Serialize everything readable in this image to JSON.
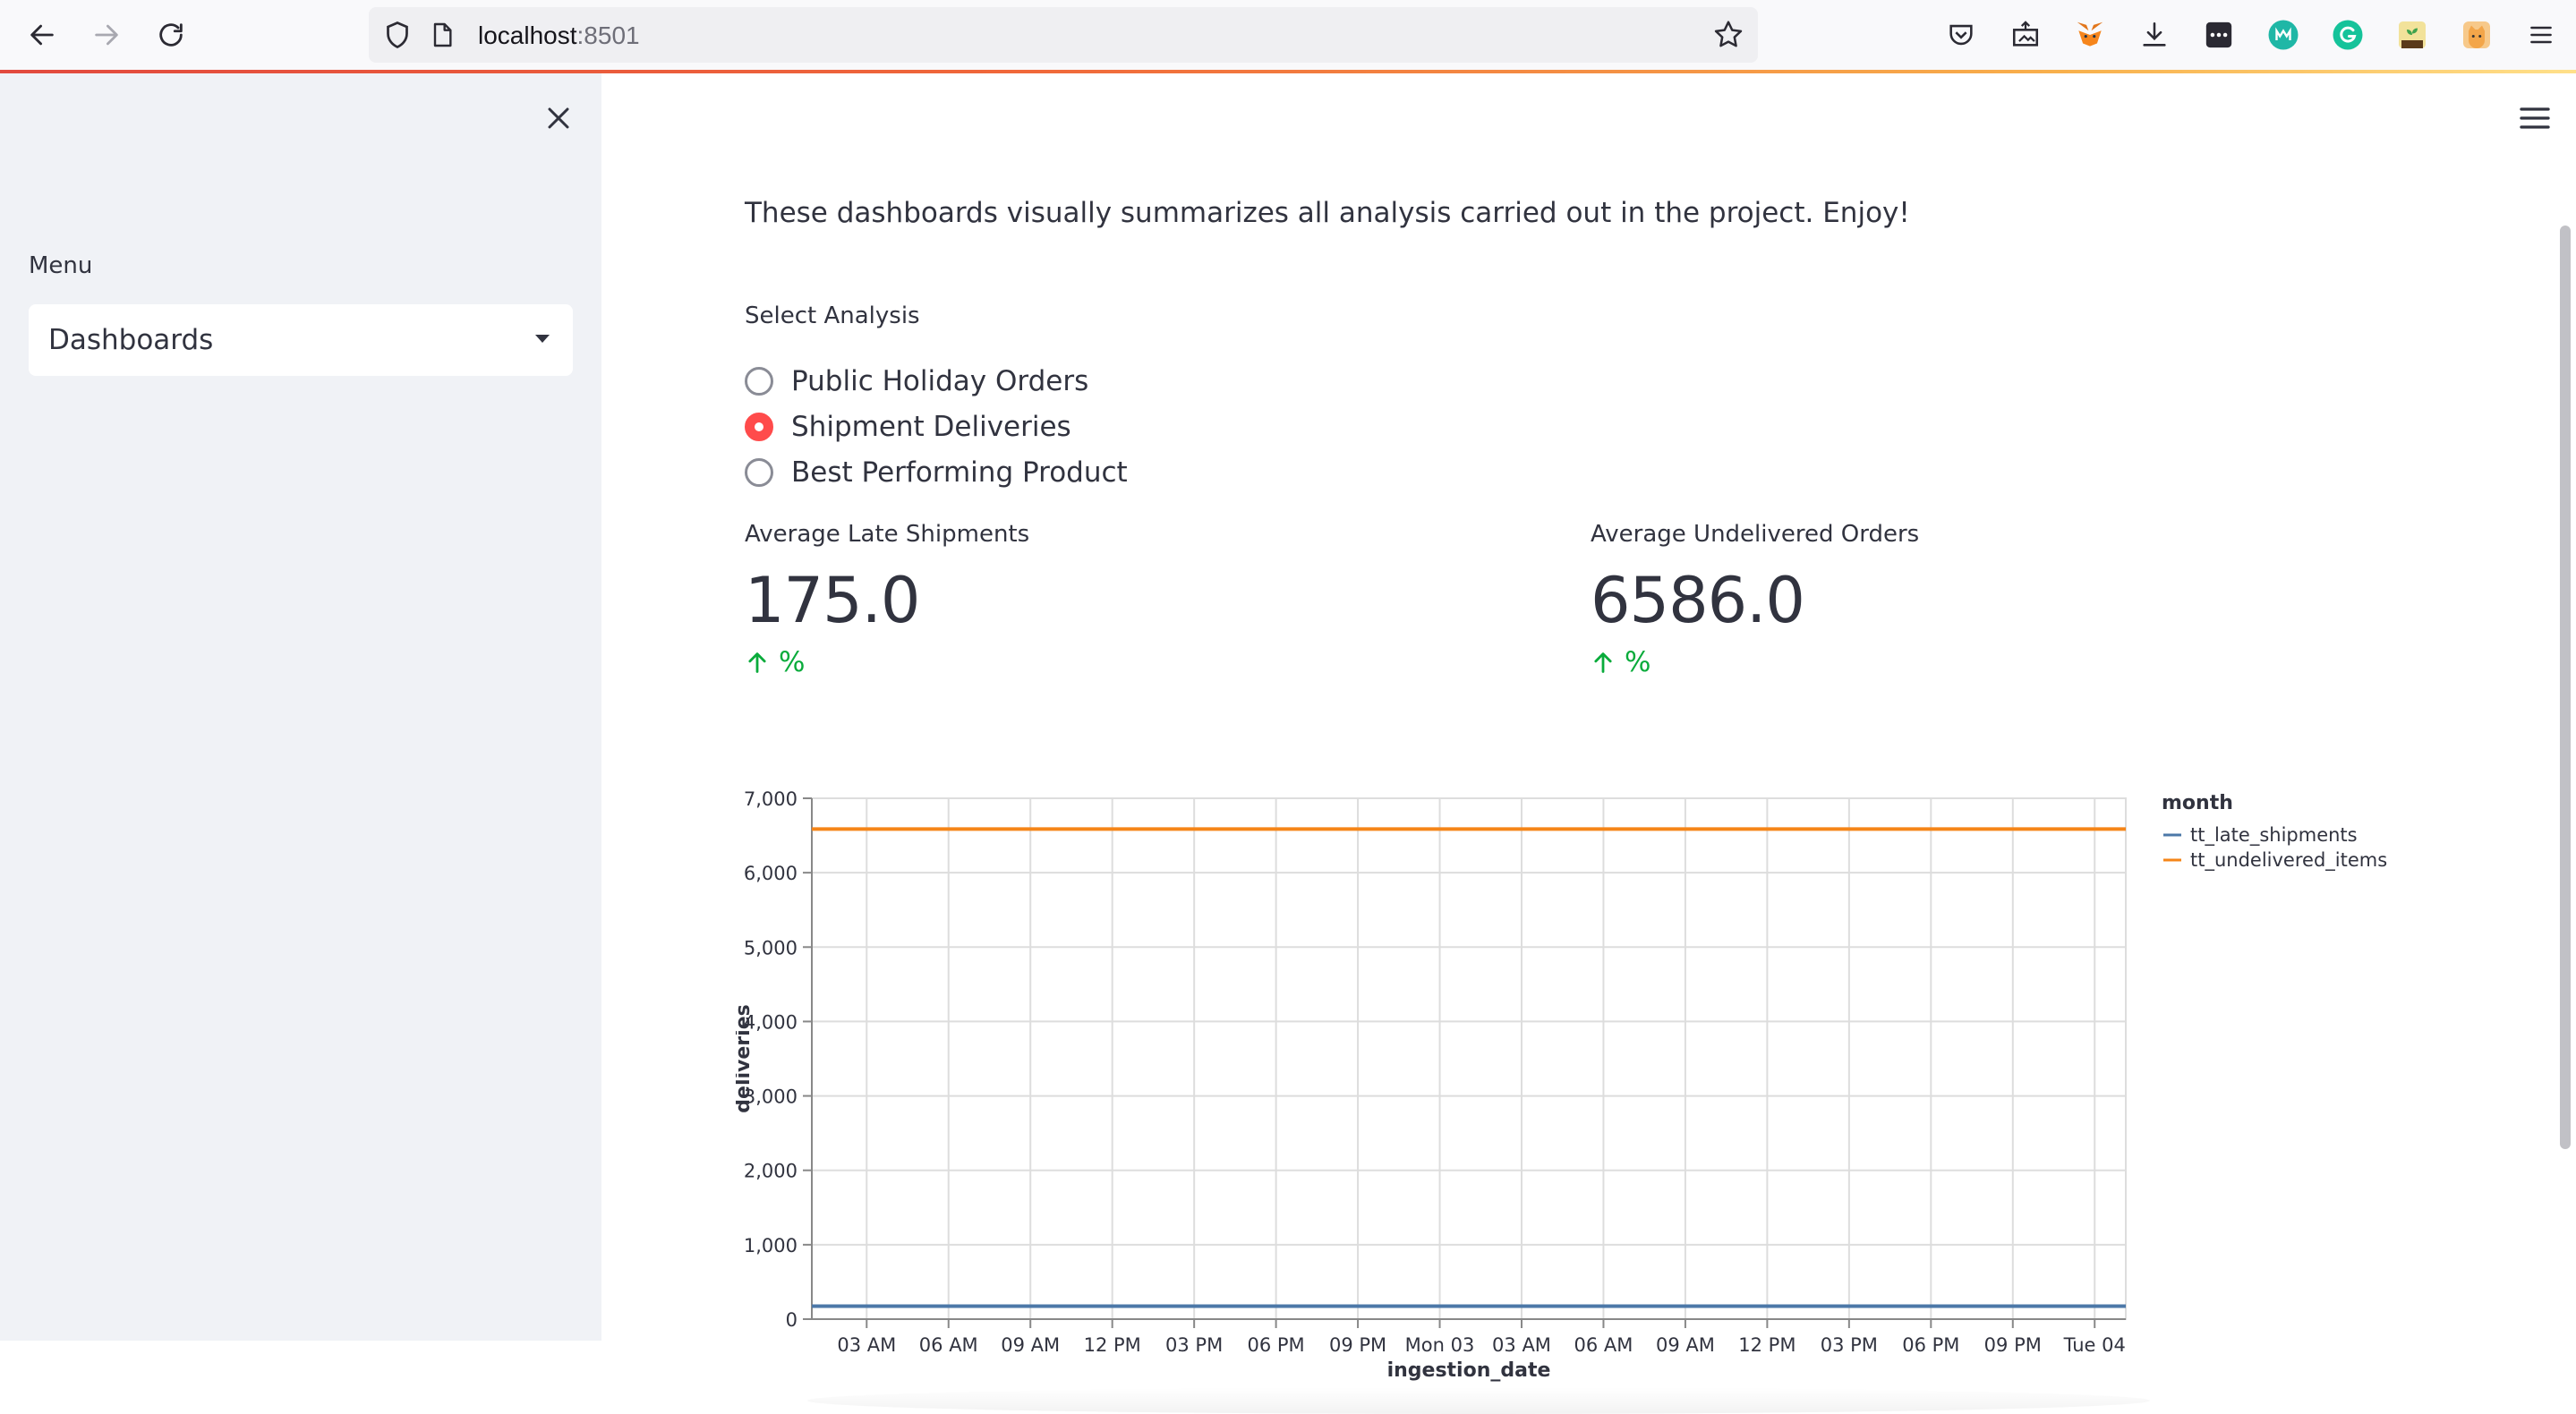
{
  "browser": {
    "url_host": "localhost",
    "url_port": ":8501",
    "back_icon": "arrow-left-icon",
    "forward_icon": "arrow-right-icon",
    "reload_icon": "reload-icon",
    "extensions": [
      "pocket-icon",
      "screenshot-icon",
      "metamask-icon",
      "download-icon",
      "extension-dots-icon",
      "m-extension-icon",
      "grammarly-icon",
      "plant-extension-icon",
      "cat-extension-icon",
      "menu-icon"
    ]
  },
  "sidebar": {
    "menu_label": "Menu",
    "select_value": "Dashboards"
  },
  "main": {
    "intro": "These dashboards visually summarizes all analysis carried out in the project. Enjoy!",
    "radio_label": "Select Analysis",
    "options": [
      {
        "label": "Public Holiday Orders",
        "checked": false
      },
      {
        "label": "Shipment Deliveries",
        "checked": true
      },
      {
        "label": "Best Performing Product",
        "checked": false
      }
    ],
    "metrics": [
      {
        "label": "Average Late Shipments",
        "value": "175.0",
        "delta": "%"
      },
      {
        "label": "Average Undelivered Orders",
        "value": "6586.0",
        "delta": "%"
      }
    ]
  },
  "chart_data": {
    "type": "line",
    "xlabel": "ingestion_date",
    "ylabel": "deliveries",
    "ylim": [
      0,
      7000
    ],
    "yticks": [
      0,
      1000,
      2000,
      3000,
      4000,
      5000,
      6000,
      7000
    ],
    "ytick_labels": [
      "0",
      "1,000",
      "2,000",
      "3,000",
      "4,000",
      "5,000",
      "6,000",
      "7,000"
    ],
    "xtick_labels": [
      "03 AM",
      "06 AM",
      "09 AM",
      "12 PM",
      "03 PM",
      "06 PM",
      "09 PM",
      "Mon 03",
      "03 AM",
      "06 AM",
      "09 AM",
      "12 PM",
      "03 PM",
      "06 PM",
      "09 PM",
      "Tue 04"
    ],
    "legend_title": "month",
    "legend_position": "right",
    "grid": true,
    "series": [
      {
        "name": "tt_late_shipments",
        "color": "#4c78a8",
        "values": [
          175,
          175
        ]
      },
      {
        "name": "tt_undelivered_items",
        "color": "#f58518",
        "values": [
          6586,
          6586
        ]
      }
    ]
  },
  "colors": {
    "accent": "#ff4b4b",
    "delta_up": "#09ab3b",
    "sidebar_bg": "#f0f2f6"
  }
}
